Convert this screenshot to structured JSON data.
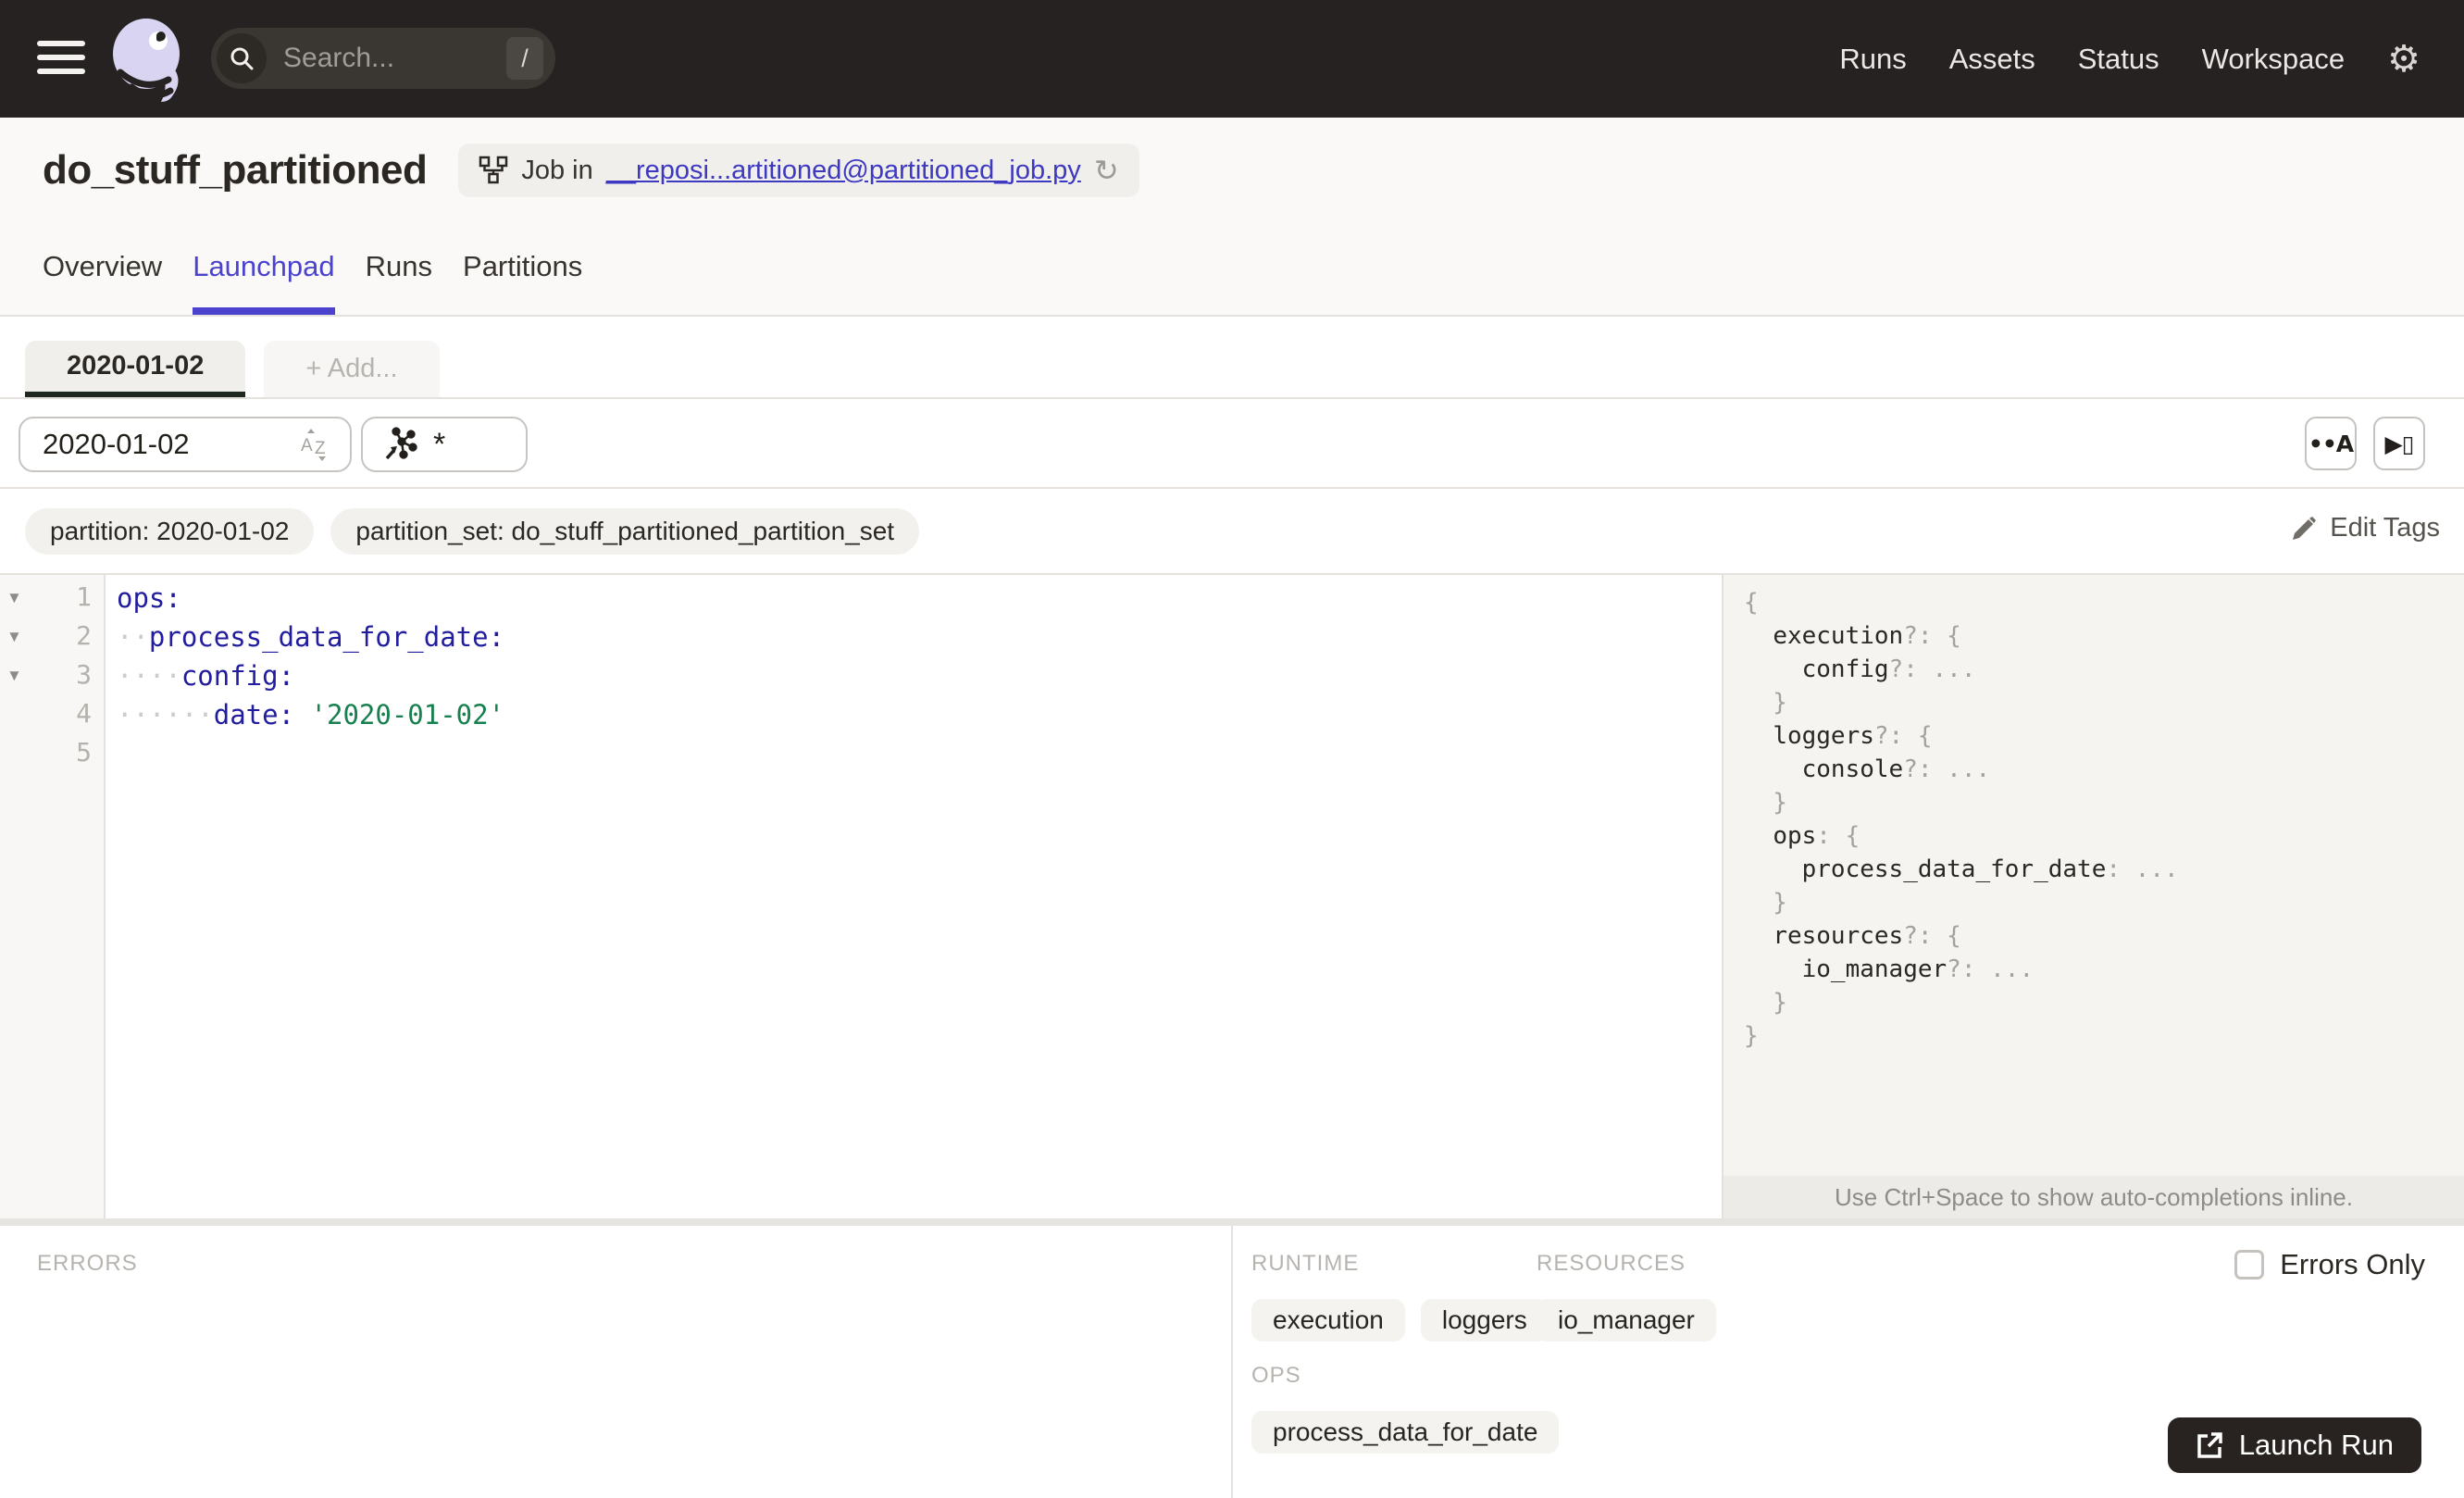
{
  "topbar": {
    "search_placeholder": "Search...",
    "search_shortcut": "/",
    "nav": [
      {
        "label": "Runs"
      },
      {
        "label": "Assets"
      },
      {
        "label": "Status"
      },
      {
        "label": "Workspace"
      }
    ]
  },
  "header": {
    "title": "do_stuff_partitioned",
    "badge_prefix": "Job in",
    "badge_link": "__reposi...artitioned@partitioned_job.py",
    "tabs": [
      {
        "label": "Overview",
        "active": false
      },
      {
        "label": "Launchpad",
        "active": true
      },
      {
        "label": "Runs",
        "active": false
      },
      {
        "label": "Partitions",
        "active": false
      }
    ]
  },
  "config": {
    "partition_tab": "2020-01-02",
    "add_tab": "+ Add...",
    "partition_select_value": "2020-01-02",
    "op_selection_value": "*",
    "editor_buttons": [
      {
        "glyph": "••A",
        "name": "whitespace-toggle-button"
      },
      {
        "glyph": "▶▯",
        "name": "scroll-to-cursor-button"
      }
    ],
    "tags": [
      {
        "label": "partition: 2020-01-02"
      },
      {
        "label": "partition_set: do_stuff_partitioned_partition_set"
      }
    ],
    "edit_tags_label": "Edit Tags"
  },
  "editor": {
    "lines": [
      {
        "num": "1",
        "fold": true,
        "segs": [
          {
            "c": "key",
            "t": "ops:"
          }
        ]
      },
      {
        "num": "2",
        "fold": true,
        "segs": [
          {
            "c": "ws",
            "t": "··"
          },
          {
            "c": "key",
            "t": "process_data_for_date:"
          }
        ]
      },
      {
        "num": "3",
        "fold": true,
        "segs": [
          {
            "c": "ws",
            "t": "····"
          },
          {
            "c": "key",
            "t": "config:"
          }
        ]
      },
      {
        "num": "4",
        "fold": false,
        "segs": [
          {
            "c": "ws",
            "t": "······"
          },
          {
            "c": "key",
            "t": "date:"
          },
          {
            "c": "plain",
            "t": " "
          },
          {
            "c": "str",
            "t": "'2020-01-02'"
          }
        ]
      },
      {
        "num": "5",
        "fold": false,
        "segs": []
      }
    ]
  },
  "schema": {
    "lines": [
      [
        {
          "c": "p",
          "t": "{"
        }
      ],
      [
        {
          "c": "p",
          "t": "  "
        },
        {
          "c": "k",
          "t": "execution"
        },
        {
          "c": "p",
          "t": "?: {"
        }
      ],
      [
        {
          "c": "p",
          "t": "    "
        },
        {
          "c": "k",
          "t": "config"
        },
        {
          "c": "p",
          "t": "?: ..."
        }
      ],
      [
        {
          "c": "p",
          "t": "  }"
        }
      ],
      [
        {
          "c": "p",
          "t": "  "
        },
        {
          "c": "k",
          "t": "loggers"
        },
        {
          "c": "p",
          "t": "?: {"
        }
      ],
      [
        {
          "c": "p",
          "t": "    "
        },
        {
          "c": "k",
          "t": "console"
        },
        {
          "c": "p",
          "t": "?: ..."
        }
      ],
      [
        {
          "c": "p",
          "t": "  }"
        }
      ],
      [
        {
          "c": "p",
          "t": "  "
        },
        {
          "c": "k",
          "t": "ops"
        },
        {
          "c": "p",
          "t": ": {"
        }
      ],
      [
        {
          "c": "p",
          "t": "    "
        },
        {
          "c": "k",
          "t": "process_data_for_date"
        },
        {
          "c": "p",
          "t": ": ..."
        }
      ],
      [
        {
          "c": "p",
          "t": "  }"
        }
      ],
      [
        {
          "c": "p",
          "t": "  "
        },
        {
          "c": "k",
          "t": "resources"
        },
        {
          "c": "p",
          "t": "?: {"
        }
      ],
      [
        {
          "c": "p",
          "t": "    "
        },
        {
          "c": "k",
          "t": "io_manager"
        },
        {
          "c": "p",
          "t": "?: ..."
        }
      ],
      [
        {
          "c": "p",
          "t": "  }"
        }
      ],
      [
        {
          "c": "p",
          "t": "}"
        }
      ]
    ],
    "hint": "Use Ctrl+Space to show auto-completions inline."
  },
  "bottom": {
    "errors_label": "ERRORS",
    "runtime_label": "RUNTIME",
    "resources_label": "RESOURCES",
    "ops_label": "OPS",
    "runtime_chips": [
      {
        "label": "execution"
      },
      {
        "label": "loggers"
      }
    ],
    "resources_chips": [
      {
        "label": "io_manager"
      }
    ],
    "ops_chips": [
      {
        "label": "process_data_for_date"
      }
    ],
    "errors_only_label": "Errors Only",
    "launch_label": "Launch Run"
  },
  "colors": {
    "topbar_bg": "#262221",
    "accent_blurple": "#4b43ce",
    "link_blue": "#3d39c0",
    "yaml_key": "#211d9e",
    "yaml_string": "#17804e",
    "active_config_tab_underline": "#20291f",
    "logo_lavender": "#d8d4f2"
  }
}
